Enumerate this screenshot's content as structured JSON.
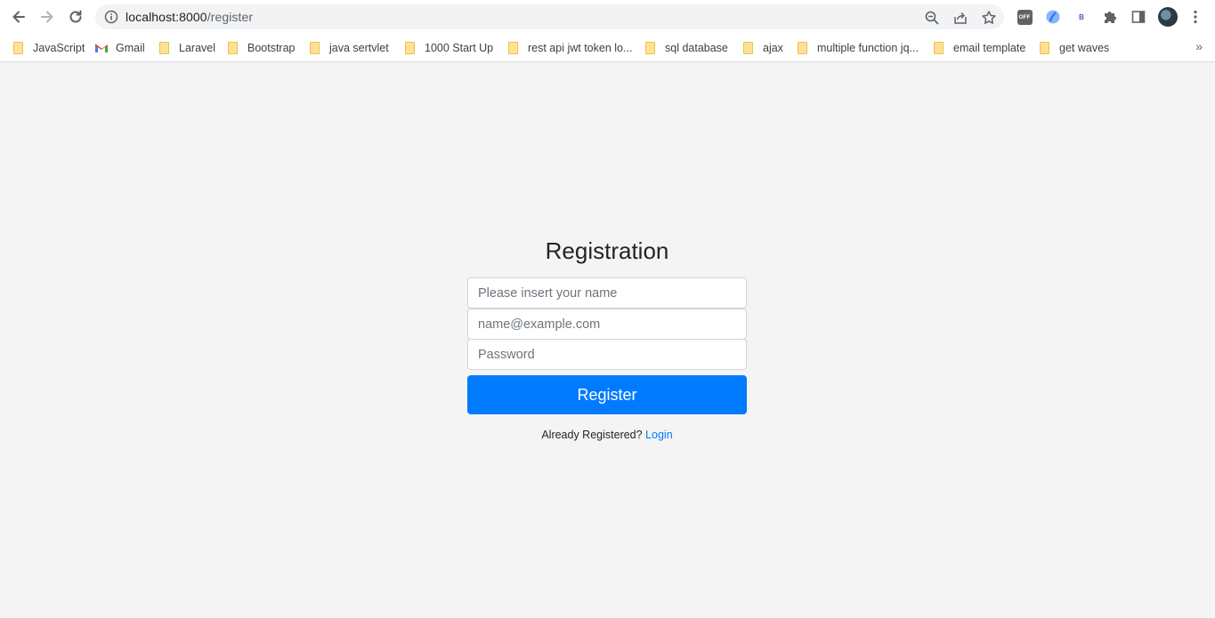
{
  "browser": {
    "url_host": "localhost:8000",
    "url_path": "/register",
    "ext_off_label": "OFF",
    "ext_b_label": "B"
  },
  "bookmarks": [
    {
      "label": "JavaScript",
      "icon": "folder-icon"
    },
    {
      "label": "Gmail",
      "icon": "gmail-icon"
    },
    {
      "label": "Laravel",
      "icon": "folder-icon"
    },
    {
      "label": "Bootstrap",
      "icon": "folder-icon"
    },
    {
      "label": "java sertvlet",
      "icon": "folder-icon"
    },
    {
      "label": "1000 Start Up",
      "icon": "folder-icon"
    },
    {
      "label": "rest api jwt token lo...",
      "icon": "folder-icon"
    },
    {
      "label": "sql database",
      "icon": "folder-icon"
    },
    {
      "label": "ajax",
      "icon": "folder-icon"
    },
    {
      "label": "multiple function jq...",
      "icon": "folder-icon"
    },
    {
      "label": "email template",
      "icon": "folder-icon"
    },
    {
      "label": "get waves",
      "icon": "folder-icon"
    }
  ],
  "bookmarks_more": "»",
  "form": {
    "title": "Registration",
    "name_placeholder": "Please insert your name",
    "email_placeholder": "name@example.com",
    "password_placeholder": "Password",
    "register_label": "Register",
    "already_text": "Already Registered?",
    "login_label": "Login"
  },
  "colors": {
    "accent": "#007bff",
    "page_bg": "#f4f4f4"
  }
}
